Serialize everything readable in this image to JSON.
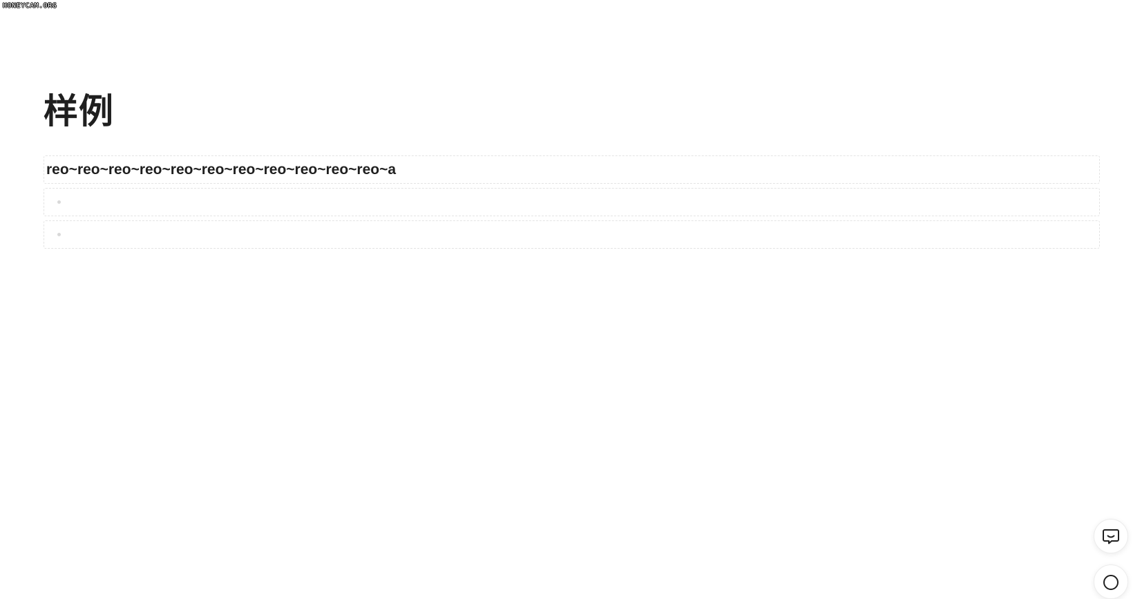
{
  "watermark": "HONEYCAM.ORG",
  "page": {
    "title": "样例"
  },
  "blocks": [
    {
      "type": "heading",
      "text": "reo~reo~reo~reo~reo~reo~reo~reo~reo~reo~reo~a"
    },
    {
      "type": "bullet",
      "text": ""
    },
    {
      "type": "bullet",
      "text": ""
    }
  ],
  "floating_buttons": [
    {
      "icon": "chat-bubble-icon"
    },
    {
      "icon": "help-icon"
    }
  ]
}
